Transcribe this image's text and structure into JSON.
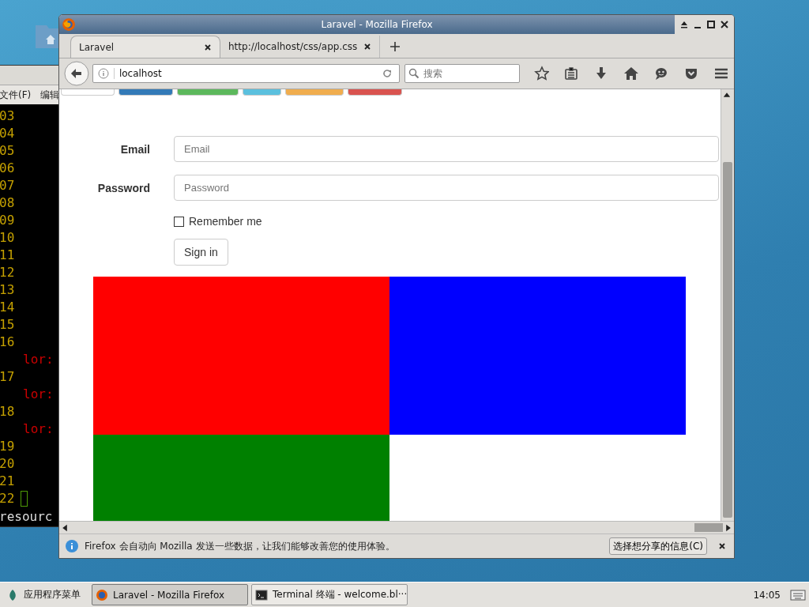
{
  "terminal": {
    "menu": [
      "文件(F)",
      "编辑"
    ],
    "lines": [
      {
        "kind": "number",
        "text": "03",
        "cursor": false
      },
      {
        "kind": "number",
        "text": "04",
        "cursor": false
      },
      {
        "kind": "number",
        "text": "05",
        "cursor": false
      },
      {
        "kind": "number",
        "text": "06",
        "cursor": false
      },
      {
        "kind": "number",
        "text": "07",
        "cursor": false
      },
      {
        "kind": "number",
        "text": "08",
        "cursor": false
      },
      {
        "kind": "number",
        "text": "09",
        "cursor": false
      },
      {
        "kind": "number",
        "text": "10",
        "cursor": false
      },
      {
        "kind": "number",
        "text": "11",
        "cursor": false
      },
      {
        "kind": "number",
        "text": "12",
        "cursor": false
      },
      {
        "kind": "number",
        "text": "13",
        "cursor": false
      },
      {
        "kind": "number",
        "text": "14",
        "cursor": false
      },
      {
        "kind": "number",
        "text": "15",
        "cursor": false
      },
      {
        "kind": "number",
        "text": "16",
        "cursor": false
      },
      {
        "kind": "error",
        "text": "lor:",
        "cursor": false
      },
      {
        "kind": "number",
        "text": "17",
        "cursor": false
      },
      {
        "kind": "error",
        "text": "lor:",
        "cursor": false
      },
      {
        "kind": "number",
        "text": "18",
        "cursor": false
      },
      {
        "kind": "error",
        "text": "lor:",
        "cursor": false
      },
      {
        "kind": "number",
        "text": "19",
        "cursor": false
      },
      {
        "kind": "number",
        "text": "20",
        "cursor": false
      },
      {
        "kind": "number",
        "text": "21",
        "cursor": false
      },
      {
        "kind": "number",
        "text": "22",
        "cursor": true
      }
    ],
    "status": "resourc"
  },
  "browser": {
    "title": "Laravel - Mozilla Firefox",
    "tabs": [
      {
        "label": "Laravel",
        "selected": true
      },
      {
        "label": "http://localhost/css/app.css",
        "selected": false
      }
    ],
    "url": "localhost",
    "search": {
      "placeholder": "搜索"
    },
    "page": {
      "top_buttons": [
        {
          "color": "#ffffff"
        },
        {
          "color": "#337ab7"
        },
        {
          "color": "#5cb85c"
        },
        {
          "color": "#5bc0de"
        },
        {
          "color": "#f0ad4e"
        },
        {
          "color": "#d9534f"
        }
      ],
      "form": {
        "fields": [
          {
            "label": "Email",
            "placeholder": "Email"
          },
          {
            "label": "Password",
            "placeholder": "Password"
          }
        ],
        "remember": {
          "label": "Remember me",
          "checked": false
        },
        "submit": "Sign in"
      },
      "blocks": [
        {
          "color": "#ff0000"
        },
        {
          "color": "#0000ff"
        },
        {
          "color": "#008000"
        }
      ]
    },
    "notification": {
      "text": "Firefox 会自动向 Mozilla 发送一些数据，让我们能够改善您的使用体验。",
      "button": "选择想分享的信息(C)"
    }
  },
  "taskbar": {
    "menu": "应用程序菜单",
    "tasks": [
      {
        "label": "Laravel - Mozilla Firefox",
        "selected": true
      },
      {
        "label": "Terminal 终端 - welcome.bl···",
        "selected": false
      }
    ],
    "clock": "14:05"
  }
}
